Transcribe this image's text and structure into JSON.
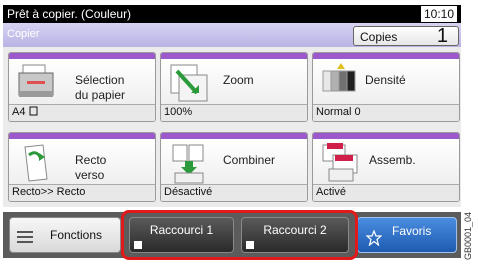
{
  "status": {
    "message": "Prêt à copier. (Couleur)",
    "time": "10:10"
  },
  "title": "Copier",
  "copies": {
    "label": "Copies",
    "value": "1"
  },
  "tiles": [
    {
      "label_lines": [
        "Sélection",
        "du papier"
      ],
      "value": "A4"
    },
    {
      "label_lines": [
        "Zoom"
      ],
      "value": "100%"
    },
    {
      "label_lines": [
        "Densité"
      ],
      "value": "Normal 0"
    },
    {
      "label_lines": [
        "Recto",
        "verso"
      ],
      "value": "Recto>> Recto"
    },
    {
      "label_lines": [
        "Combiner"
      ],
      "value": "Désactivé"
    },
    {
      "label_lines": [
        "Assemb."
      ],
      "value": "Activé"
    }
  ],
  "bottom": {
    "functions": "Fonctions",
    "shortcut1": "Raccourci 1",
    "shortcut2": "Raccourci 2",
    "favorites": "Favoris"
  },
  "figure_code": "GB0001_04",
  "colors": {
    "accent_purple": "#9b59cc",
    "favorites_blue": "#1e5bb0",
    "highlight_red": "#e01a1a"
  }
}
